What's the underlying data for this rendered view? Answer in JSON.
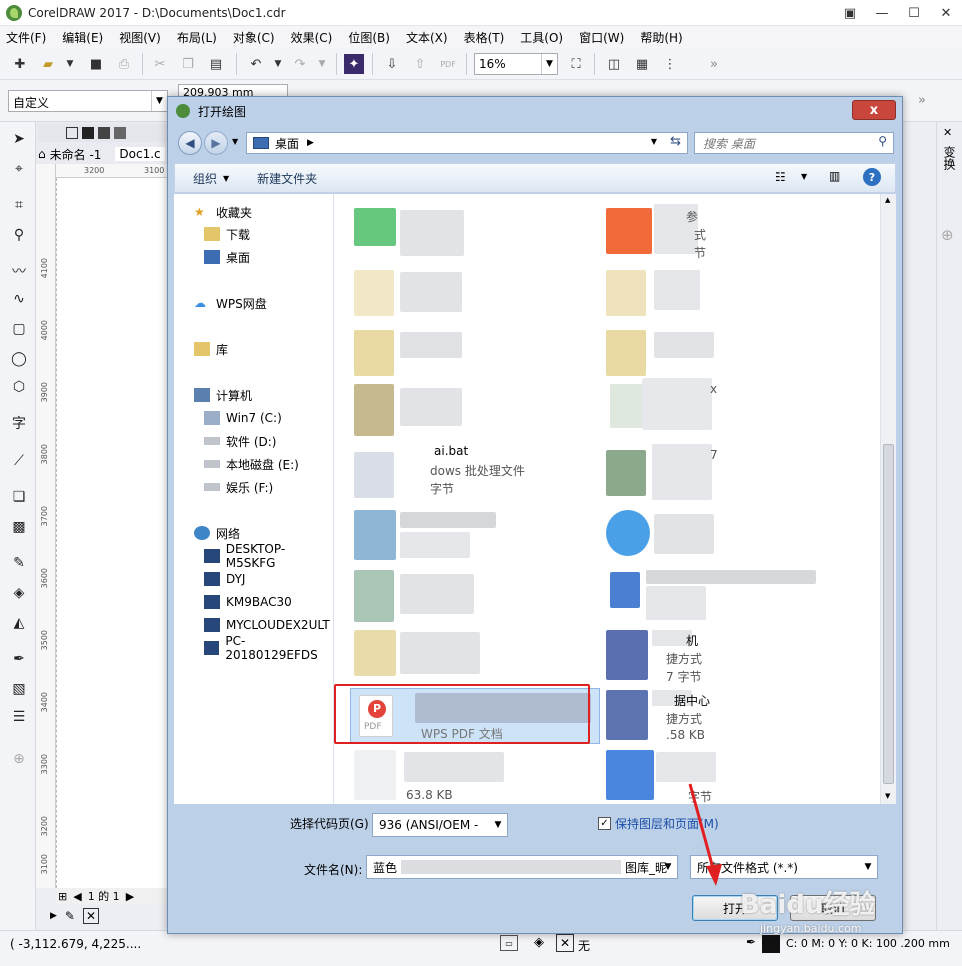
{
  "window": {
    "title": "CorelDRAW 2017 - D:\\Documents\\Doc1.cdr"
  },
  "menu": [
    "文件(F)",
    "编辑(E)",
    "视图(V)",
    "布局(L)",
    "对象(C)",
    "效果(C)",
    "位图(B)",
    "文本(X)",
    "表格(T)",
    "工具(O)",
    "窗口(W)",
    "帮助(H)"
  ],
  "toolbar": {
    "zoom": "16%",
    "preset": "自定义",
    "width": "209.903 mm"
  },
  "doc": {
    "tab1": "未命名 -1",
    "tab2": "Doc1.c",
    "ruler_h1": "3200",
    "ruler_h2": "3100",
    "ruler_v": [
      "4100",
      "4000",
      "3900",
      "3800",
      "3700",
      "3600",
      "3500",
      "3400",
      "3300",
      "3200",
      "3100"
    ],
    "page_indicator": "1 的 1"
  },
  "docker": {
    "label": "变换"
  },
  "status": {
    "coords": "( -3,112.679, 4,225....",
    "fill_none": "无",
    "color_info": "C: 0 M: 0 Y: 0 K: 100   .200 mm"
  },
  "dialog": {
    "title": "打开绘图",
    "close": "x",
    "address": "桌面",
    "search_placeholder": "搜索 桌面",
    "organize": "组织",
    "new_folder": "新建文件夹",
    "nav": {
      "favorites": "收藏夹",
      "downloads": "下载",
      "desktop": "桌面",
      "wps": "WPS网盘",
      "library": "库",
      "computer": "计算机",
      "drive_c": "Win7 (C:)",
      "drive_d": "软件 (D:)",
      "drive_e": "本地磁盘 (E:)",
      "drive_f": "娱乐 (F:)",
      "network": "网络",
      "hosts": [
        "DESKTOP-M5SKFG",
        "DYJ",
        "KM9BAC30",
        "MYCLOUDEX2ULT",
        "PC-20180129EFDS"
      ]
    },
    "files": {
      "right_top_frag": "参",
      "right_type1": "式",
      "right_size1": "节",
      "bat_name": "ai.bat",
      "bat_type": "dows 批处理文件",
      "bat_size": "字节",
      "right_x": "x",
      "right_7": "7",
      "pdf_type": "WPS PDF 文档",
      "pdf_icon_text": "PDF",
      "lnk1_name": "机",
      "lnk1_type": "捷方式",
      "lnk1_size": "7 字节",
      "lnk2_name": "据中心",
      "lnk2_type": "捷方式",
      "lnk2_size": ".58 KB",
      "last_size": "63.8 KB",
      "last_right": "字节"
    },
    "encoding_label": "选择代码页(G)",
    "encoding_value": "936  (ANSI/OEM -",
    "keep_layers": "保持图层和页面(M)",
    "filename_label": "文件名(N):",
    "filename_start": "蓝色",
    "filename_end": "图库_昵",
    "filetype": "所有文件格式 (*.*)",
    "open_btn": "打开",
    "cancel_btn": "取消"
  },
  "watermark": {
    "text": "Baidu经验",
    "url": "jingyan.baidu.com"
  },
  "colors": {
    "highlight": "#e02020",
    "accent": "#3f6fb5"
  }
}
